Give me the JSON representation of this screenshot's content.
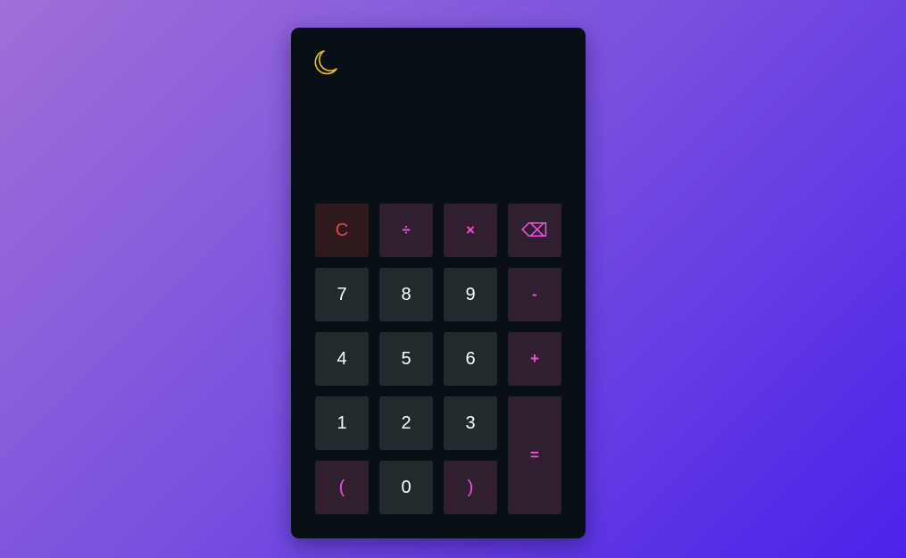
{
  "calculator": {
    "theme_toggle_icon": "moon-icon",
    "display": {
      "value": ""
    },
    "colors": {
      "background": "#091015",
      "number_key": "#212a2d",
      "operator_key": "#30202f",
      "operator_text": "#f84ee3",
      "clear_key": "#2e1a1c",
      "clear_text": "#e54547",
      "moon": "#f2c21a"
    },
    "keys": {
      "clear": "C",
      "divide": "÷",
      "multiply": "×",
      "backspace": "⌫",
      "seven": "7",
      "eight": "8",
      "nine": "9",
      "minus": "-",
      "four": "4",
      "five": "5",
      "six": "6",
      "plus": "+",
      "one": "1",
      "two": "2",
      "three": "3",
      "equals": "=",
      "open_paren": "(",
      "zero": "0",
      "close_paren": ")"
    }
  }
}
